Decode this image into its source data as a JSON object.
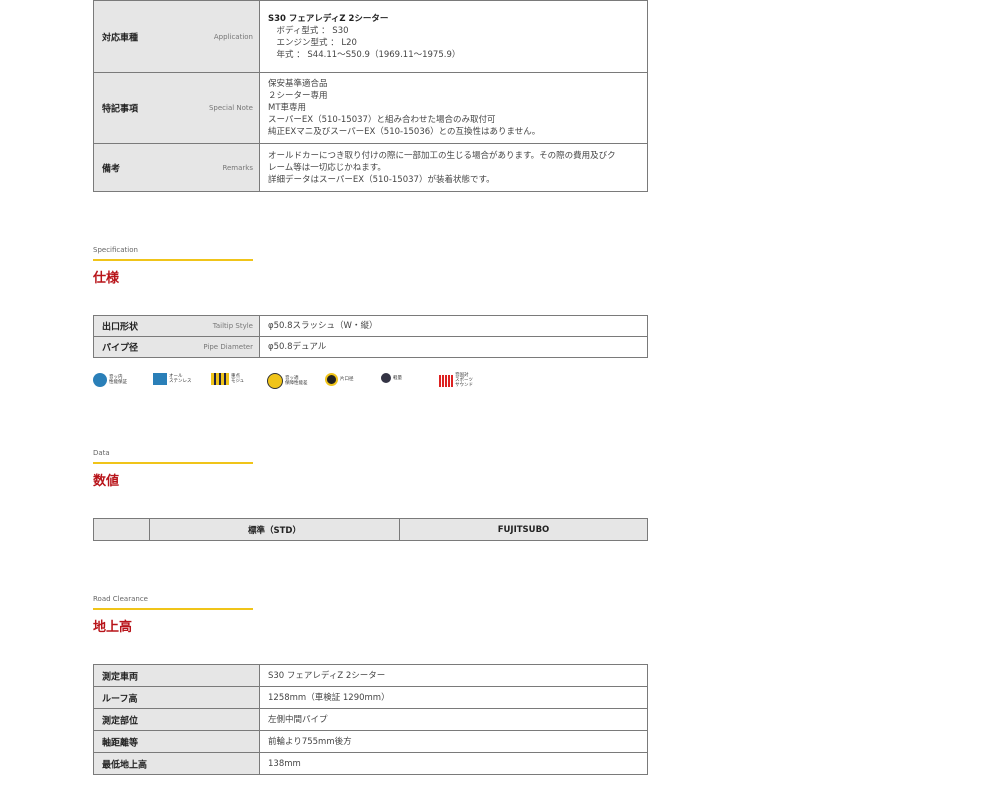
{
  "application_table": [
    {
      "label": "対応車種",
      "label_en": "Application",
      "lines": [
        {
          "text": "S30 フェアレディZ 2シーター",
          "bold": true
        },
        {
          "text": "　ボディ型式 ： S30"
        },
        {
          "text": "　エンジン型式 ： L20"
        },
        {
          "text": "　年式 ： S44.11～S50.9（1969.11～1975.9）"
        }
      ]
    },
    {
      "label": "特記事項",
      "label_en": "Special Note",
      "lines": [
        {
          "text": "保安基準適合品"
        },
        {
          "text": "２シーター専用"
        },
        {
          "text": "MT車専用"
        },
        {
          "text": "スーパーEX（510-15037）と組み合わせた場合のみ取付可"
        },
        {
          "text": "純正EXマニ及びスーパーEX（510-15036）との互換性はありません。"
        }
      ]
    },
    {
      "label": "備考",
      "label_en": "Remarks",
      "lines": [
        {
          "text": "オールドカーにつき取り付けの際に一部加工の生じる場合があります。その際の費用及びク"
        },
        {
          "text": "レーム等は一切応じかねます。"
        },
        {
          "text": "詳細データはスーパーEX（510-15037）が装着状態です。"
        }
      ]
    }
  ],
  "specification": {
    "en": "Specification",
    "ja": "仕様",
    "rows": [
      {
        "label": "出口形状",
        "label_en": "Tailtip Style",
        "value": "φ50.8スラッシュ（W・縦）"
      },
      {
        "label": "パイプ径",
        "label_en": "Pipe Diameter",
        "value": "φ50.8デュアル"
      }
    ],
    "icons": [
      {
        "name": "low-noise-icon",
        "text": "音ッ内\n性能保証",
        "color": "#2a7fb8"
      },
      {
        "name": "stainless-icon",
        "text": "オール\nステンレス",
        "color": "#2a7fb8"
      },
      {
        "name": "compact-icon",
        "text": "重点\nモジュ",
        "color": "#f0c419"
      },
      {
        "name": "sound-guarantee-icon",
        "text": "音ッ適\n保障性能差",
        "color": "#f0c419"
      },
      {
        "name": "single-icon",
        "text": "片口径",
        "color": "#222"
      },
      {
        "name": "weight-icon",
        "text": "軽量",
        "color": "#334"
      },
      {
        "name": "sound-icon",
        "text": "音国対\nスポーツ\nサウンド",
        "color": "#d22"
      }
    ]
  },
  "data_section": {
    "en": "Data",
    "ja": "数値",
    "headers": [
      "",
      "標準（STD）",
      "FUJITSUBO"
    ]
  },
  "clearance": {
    "en": "Road Clearance",
    "ja": "地上高",
    "rows": [
      {
        "label": "測定車両",
        "value": "S30 フェアレディZ 2シーター"
      },
      {
        "label": "ルーフ高",
        "value": "1258mm（車検証 1290mm）"
      },
      {
        "label": "測定部位",
        "value": "左側中間パイプ"
      },
      {
        "label": "軸距離等",
        "value": "前輪より755mm後方"
      },
      {
        "label": "最低地上高",
        "value": "138mm"
      }
    ]
  }
}
